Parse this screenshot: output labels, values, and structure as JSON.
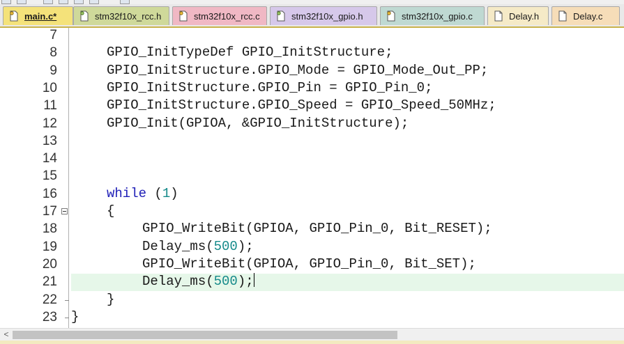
{
  "tabs": [
    {
      "label": "main.c*",
      "icon": "c-file-icon",
      "active": true,
      "color": "#f4e27a"
    },
    {
      "label": "stm32f10x_rcc.h",
      "icon": "header-file-icon",
      "active": false,
      "color": "#cfd99a"
    },
    {
      "label": "stm32f10x_rcc.c",
      "icon": "c-file-icon",
      "active": false,
      "color": "#f0b8c4"
    },
    {
      "label": "stm32f10x_gpio.h",
      "icon": "header-file-icon",
      "active": false,
      "color": "#d6c8ea"
    },
    {
      "label": "stm32f10x_gpio.c",
      "icon": "c-file-icon",
      "active": false,
      "color": "#bfd9d2"
    },
    {
      "label": "Delay.h",
      "icon": "document-icon",
      "active": false,
      "color": "#f5eac7"
    },
    {
      "label": "Delay.c",
      "icon": "document-icon",
      "active": false,
      "color": "#f6ddb8"
    }
  ],
  "editor": {
    "current_line": "21",
    "lines": [
      {
        "number": "7",
        "code": ""
      },
      {
        "number": "8",
        "code": "GPIO_InitTypeDef GPIO_InitStructure;"
      },
      {
        "number": "9",
        "code": "GPIO_InitStructure.GPIO_Mode = GPIO_Mode_Out_PP;"
      },
      {
        "number": "10",
        "code": "GPIO_InitStructure.GPIO_Pin = GPIO_Pin_0;"
      },
      {
        "number": "11",
        "code": "GPIO_InitStructure.GPIO_Speed = GPIO_Speed_50MHz;"
      },
      {
        "number": "12",
        "code": "GPIO_Init(GPIOA, &GPIO_InitStructure);"
      },
      {
        "number": "13",
        "code": ""
      },
      {
        "number": "14",
        "code": ""
      },
      {
        "number": "15",
        "code": ""
      },
      {
        "number": "16",
        "code": "while (1)"
      },
      {
        "number": "17",
        "code": "{"
      },
      {
        "number": "18",
        "code": "GPIO_WriteBit(GPIOA, GPIO_Pin_0, Bit_RESET);"
      },
      {
        "number": "19",
        "code": "Delay_ms(500);"
      },
      {
        "number": "20",
        "code": "GPIO_WriteBit(GPIOA, GPIO_Pin_0, Bit_SET);"
      },
      {
        "number": "21",
        "code": "Delay_ms(500);"
      },
      {
        "number": "22",
        "code": "}"
      },
      {
        "number": "23",
        "code": "}"
      }
    ]
  },
  "scrollbar": {
    "left_arrow": "<"
  },
  "colors": {
    "keyword": "#2121b8",
    "number": "#158a8a",
    "current_line_bg": "#e6f7e9",
    "active_tab": "#f4e27a"
  }
}
